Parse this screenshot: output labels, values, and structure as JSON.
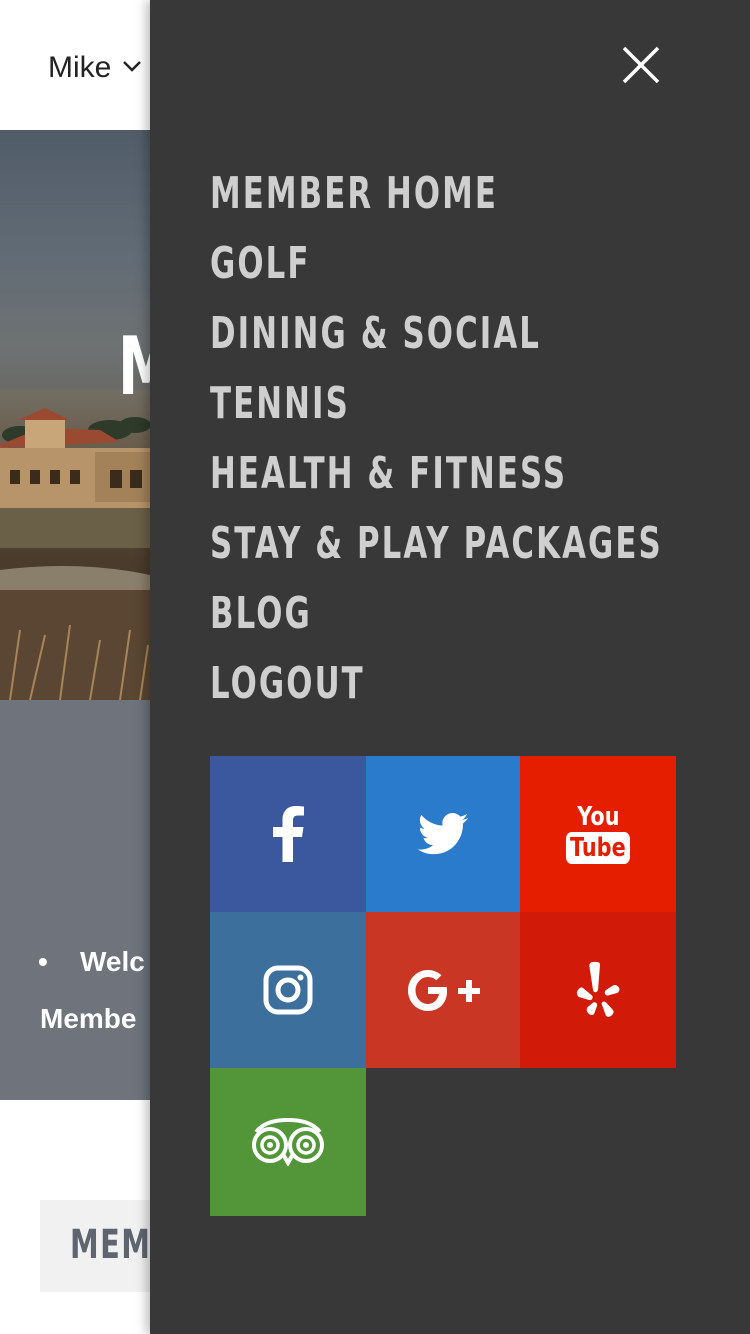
{
  "header": {
    "user_name": "Mike"
  },
  "hero": {
    "title_fragment": "M"
  },
  "info": {
    "bullet": "•",
    "line1": "Welc",
    "line2": "Membe"
  },
  "member_button": {
    "label": "MEMB"
  },
  "drawer": {
    "nav_items": [
      {
        "label": "MEMBER HOME"
      },
      {
        "label": "GOLF"
      },
      {
        "label": "DINING & SOCIAL"
      },
      {
        "label": "TENNIS"
      },
      {
        "label": "HEALTH & FITNESS"
      },
      {
        "label": "STAY & PLAY PACKAGES"
      },
      {
        "label": "BLOG"
      },
      {
        "label": "LOGOUT"
      }
    ],
    "social": {
      "youtube_text_top": "You",
      "youtube_text_bottom": "Tube",
      "colors": {
        "facebook": "#3b579d",
        "twitter": "#2a7bcc",
        "youtube": "#e61e00",
        "instagram": "#3d6f9c",
        "google_plus": "#c93623",
        "yelp": "#d21a08",
        "tripadvisor": "#53963a"
      }
    }
  }
}
